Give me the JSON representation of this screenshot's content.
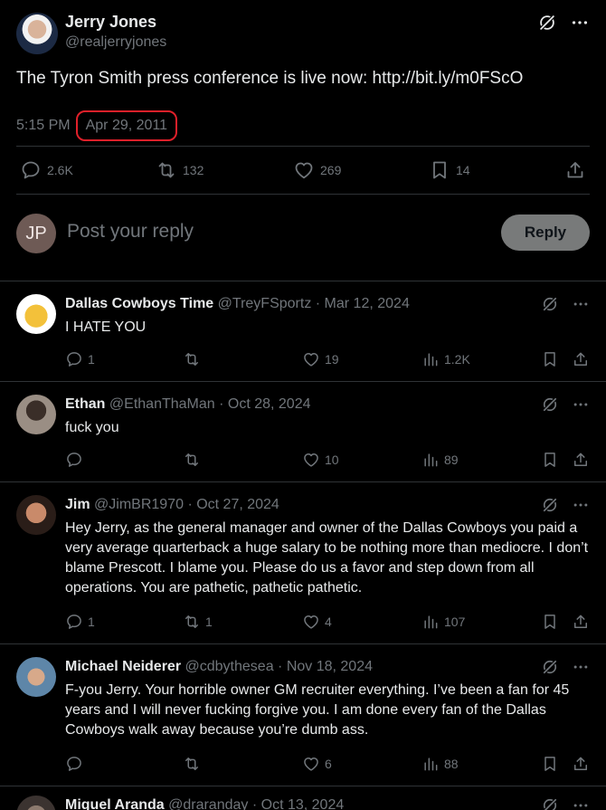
{
  "main_tweet": {
    "author_name": "Jerry Jones",
    "author_handle": "@realjerryjones",
    "text": "The Tyron Smith press conference is live now:  http://bit.ly/m0FScO",
    "time": "5:15 PM",
    "separator": "·",
    "date": "Apr 29, 2011",
    "replies": "2.6K",
    "retweets": "132",
    "likes": "269",
    "bookmarks": "14"
  },
  "composer": {
    "avatar_initials": "JP",
    "placeholder": "Post your reply",
    "reply_button": "Reply"
  },
  "replies": [
    {
      "name": "Dallas Cowboys Time",
      "handle": "@TreyFSportz",
      "date": "· Mar 12, 2024",
      "text": "I HATE YOU",
      "reply_count": "1",
      "retweet_count": "",
      "like_count": "19",
      "view_count": "1.2K"
    },
    {
      "name": "Ethan",
      "handle": "@EthanThaMan",
      "date": "· Oct 28, 2024",
      "text": "fuck you",
      "reply_count": "",
      "retweet_count": "",
      "like_count": "10",
      "view_count": "89"
    },
    {
      "name": "Jim",
      "handle": "@JimBR1970",
      "date": "· Oct 27, 2024",
      "text": "Hey Jerry, as the general manager and owner of the Dallas Cowboys you paid a very average quarterback a huge salary to be nothing more than mediocre. I don’t blame Prescott. I blame you. Please do us a favor and step down from all operations. You are pathetic, pathetic pathetic.",
      "reply_count": "1",
      "retweet_count": "1",
      "like_count": "4",
      "view_count": "107"
    },
    {
      "name": "Michael Neiderer",
      "handle": "@cdbythesea",
      "date": "· Nov 18, 2024",
      "text": "F-you Jerry. Your horrible owner GM recruiter everything. I’ve been a fan for 45 years and I will never fucking forgive you. I am done every fan of the Dallas Cowboys walk away because you’re dumb ass.",
      "reply_count": "",
      "retweet_count": "",
      "like_count": "6",
      "view_count": "88"
    },
    {
      "name": "Miguel Aranda",
      "handle": "@draranday",
      "date": "· Oct 13, 2024",
      "text": "",
      "reply_count": "",
      "retweet_count": "",
      "like_count": "",
      "view_count": ""
    }
  ],
  "colors": {
    "background": "#000000",
    "text": "#e7e9ea",
    "muted": "#71767b",
    "divider": "#2f3336",
    "highlight": "#e0202a",
    "reply_button": "#787a7a"
  }
}
